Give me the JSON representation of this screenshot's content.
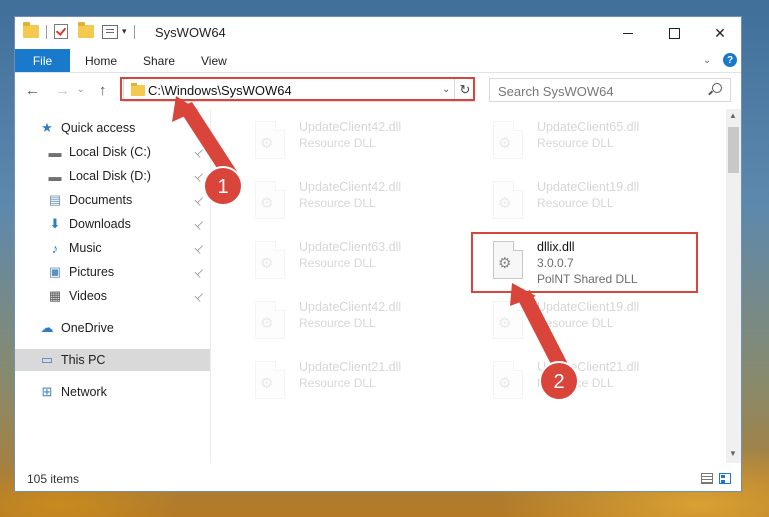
{
  "window": {
    "title": "SysWOW64",
    "minimize_icon": "minimize-icon",
    "maximize_icon": "maximize-icon",
    "close_glyph": "✕"
  },
  "quick_access_toolbar": {
    "dropdown_glyph": "▾"
  },
  "ribbon": {
    "tabs": [
      {
        "label": "File"
      },
      {
        "label": "Home"
      },
      {
        "label": "Share"
      },
      {
        "label": "View"
      }
    ],
    "collapse_glyph": "⌄",
    "help_glyph": "?"
  },
  "navigation": {
    "back_glyph": "←",
    "forward_glyph": "→",
    "recent_glyph": "⌄",
    "up_glyph": "↑",
    "address": "C:\\Windows\\SysWOW64",
    "address_dropdown_glyph": "⌄",
    "refresh_glyph": "↻",
    "search_placeholder": "Search SysWOW64"
  },
  "sidebar": {
    "items": [
      {
        "label": "Quick access",
        "icon": "star-icon",
        "glyph": "★",
        "color": "#2f7bc4"
      },
      {
        "label": "Local Disk (C:)",
        "icon": "drive-icon",
        "glyph": "▬",
        "color": "#707070",
        "pinned": true
      },
      {
        "label": "Local Disk (D:)",
        "icon": "drive-icon",
        "glyph": "▬",
        "color": "#707070",
        "pinned": true
      },
      {
        "label": "Documents",
        "icon": "documents-icon",
        "glyph": "▤",
        "color": "#6c8fb5",
        "pinned": true
      },
      {
        "label": "Downloads",
        "icon": "downloads-icon",
        "glyph": "⬇",
        "color": "#2f7bc4",
        "pinned": true
      },
      {
        "label": "Music",
        "icon": "music-icon",
        "glyph": "♪",
        "color": "#2f7bc4",
        "pinned": true
      },
      {
        "label": "Pictures",
        "icon": "pictures-icon",
        "glyph": "▣",
        "color": "#5a8fc0",
        "pinned": true
      },
      {
        "label": "Videos",
        "icon": "videos-icon",
        "glyph": "▦",
        "color": "#555555",
        "pinned": true
      },
      {
        "label": "OneDrive",
        "icon": "cloud-icon",
        "glyph": "☁",
        "color": "#2f7bc4"
      },
      {
        "label": "This PC",
        "icon": "computer-icon",
        "glyph": "▭",
        "color": "#3f7fc0",
        "selected": true
      },
      {
        "label": "Network",
        "icon": "network-icon",
        "glyph": "⊞",
        "color": "#3f7fc0"
      }
    ],
    "pin_glyph": "📌"
  },
  "files": [
    {
      "name": "UpdateClient42.dll",
      "type": "Resource DLL",
      "faded": true
    },
    {
      "name": "UpdateClient65.dll",
      "type": "Resource DLL",
      "faded": true
    },
    {
      "name": "UpdateClient42.dll",
      "type": "Resource DLL",
      "faded": true
    },
    {
      "name": "UpdateClient19.dll",
      "type": "Resource DLL",
      "faded": true
    },
    {
      "name": "UpdateClient63.dll",
      "type": "Resource DLL",
      "faded": true
    },
    {
      "name": "dllix.dll",
      "version": "3.0.0.7",
      "type": "PolNT Shared DLL",
      "faded": false
    },
    {
      "name": "UpdateClient42.dll",
      "type": "Resource DLL",
      "faded": true
    },
    {
      "name": "UpdateClient19.dll",
      "type": "Resource DLL",
      "faded": true
    },
    {
      "name": "UpdateClient21.dll",
      "type": "Resource DLL",
      "faded": true
    },
    {
      "name": "UpdateClient21.dll",
      "type": "Resource DLL",
      "faded": true
    }
  ],
  "file_icon": "gear-file-icon",
  "status": {
    "item_count": "105 items",
    "views": [
      "details-view-icon",
      "tiles-view-icon"
    ]
  },
  "scrollbar": {
    "up_glyph": "▲",
    "down_glyph": "▼"
  },
  "annotations": {
    "accent_color": "#d9453a",
    "step_1": "1",
    "step_2": "2"
  }
}
